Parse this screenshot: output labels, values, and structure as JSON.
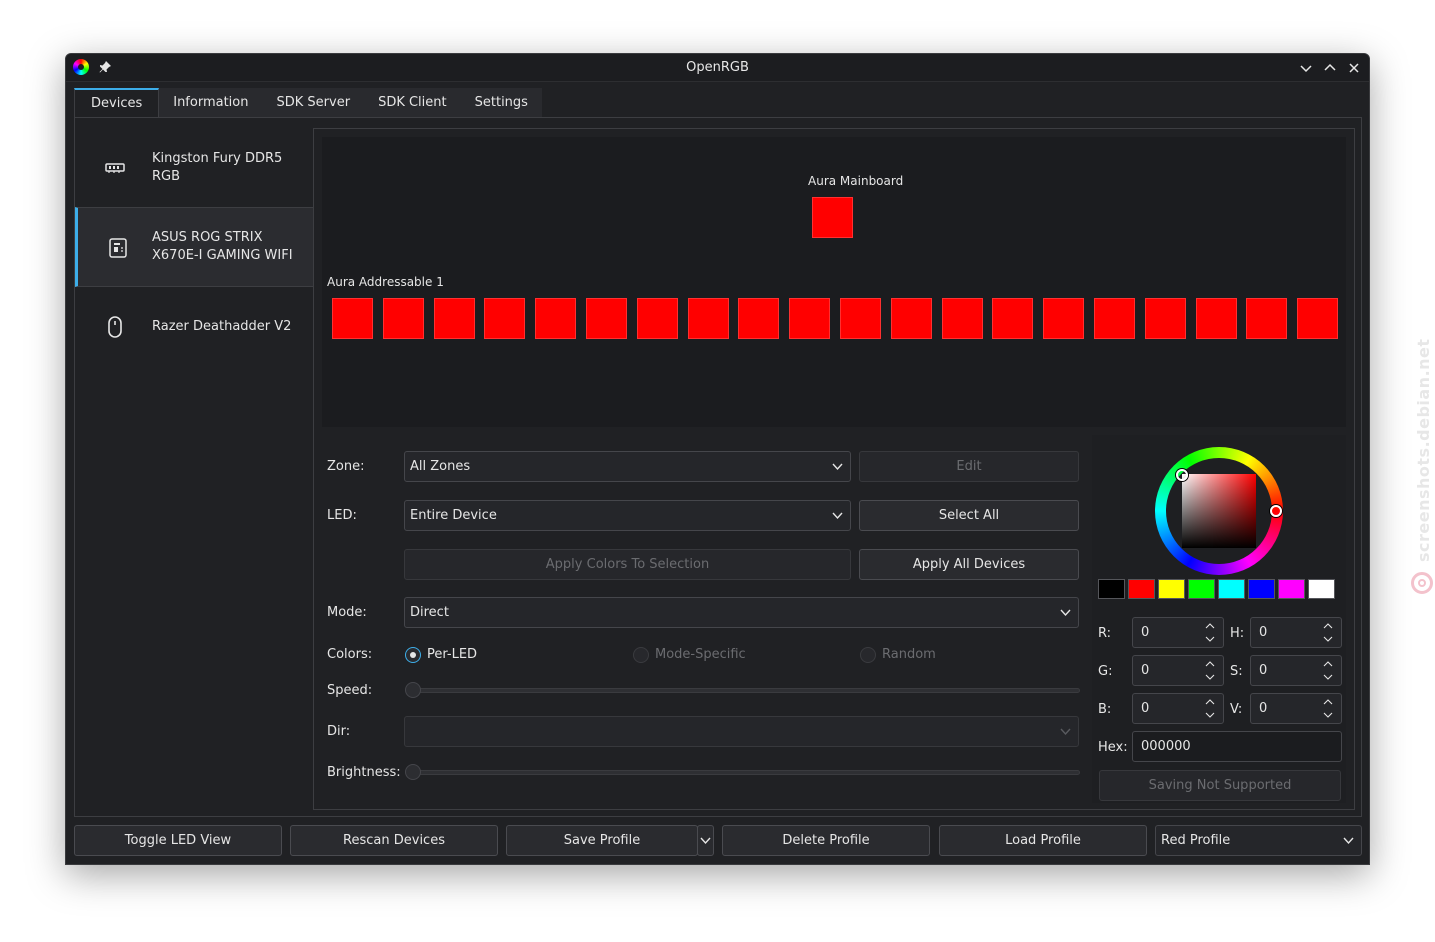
{
  "window": {
    "title": "OpenRGB"
  },
  "tabs": [
    {
      "label": "Devices",
      "active": true
    },
    {
      "label": "Information",
      "active": false
    },
    {
      "label": "SDK Server",
      "active": false
    },
    {
      "label": "SDK Client",
      "active": false
    },
    {
      "label": "Settings",
      "active": false
    }
  ],
  "devices": [
    {
      "name": "Kingston Fury DDR5 RGB",
      "icon": "ram-icon",
      "selected": false
    },
    {
      "name": "ASUS ROG STRIX X670E-I GAMING WIFI",
      "icon": "motherboard-icon",
      "selected": true
    },
    {
      "name": "Razer Deathadder V2",
      "icon": "mouse-icon",
      "selected": false
    }
  ],
  "led_view": {
    "zones": [
      {
        "name": "Aura Mainboard",
        "led_count": 1,
        "color": "#ff0000"
      },
      {
        "name": "Aura Addressable 1",
        "led_count": 20,
        "color": "#ff0000"
      }
    ]
  },
  "controls": {
    "zone_label": "Zone:",
    "zone_value": "All Zones",
    "edit_button": "Edit",
    "led_label": "LED:",
    "led_value": "Entire Device",
    "select_all_button": "Select All",
    "apply_selection_button": "Apply Colors To Selection",
    "apply_all_button": "Apply All Devices",
    "mode_label": "Mode:",
    "mode_value": "Direct",
    "colors_label": "Colors:",
    "color_modes": [
      {
        "label": "Per-LED",
        "checked": true,
        "enabled": true
      },
      {
        "label": "Mode-Specific",
        "checked": false,
        "enabled": false
      },
      {
        "label": "Random",
        "checked": false,
        "enabled": false
      }
    ],
    "speed_label": "Speed:",
    "dir_label": "Dir:",
    "dir_value": "",
    "brightness_label": "Brightness:"
  },
  "color_picker": {
    "swatches": [
      "#000000",
      "#ff0000",
      "#ffff00",
      "#00ff00",
      "#00ffff",
      "#0000ff",
      "#ff00ff",
      "#ffffff"
    ],
    "r_label": "R:",
    "r_value": "0",
    "g_label": "G:",
    "g_value": "0",
    "b_label": "B:",
    "b_value": "0",
    "h_label": "H:",
    "h_value": "0",
    "s_label": "S:",
    "s_value": "0",
    "v_label": "V:",
    "v_value": "0",
    "hex_label": "Hex:",
    "hex_value": "000000",
    "save_button": "Saving Not Supported"
  },
  "bottom_bar": {
    "toggle_led_view": "Toggle LED View",
    "rescan_devices": "Rescan Devices",
    "save_profile": "Save Profile",
    "delete_profile": "Delete Profile",
    "load_profile": "Load Profile",
    "profile_select": "Red Profile"
  },
  "watermark": "screenshots.debian.net",
  "colors": {
    "accent": "#3daee9",
    "window_bg": "#202124",
    "led_color": "#ff0000"
  }
}
